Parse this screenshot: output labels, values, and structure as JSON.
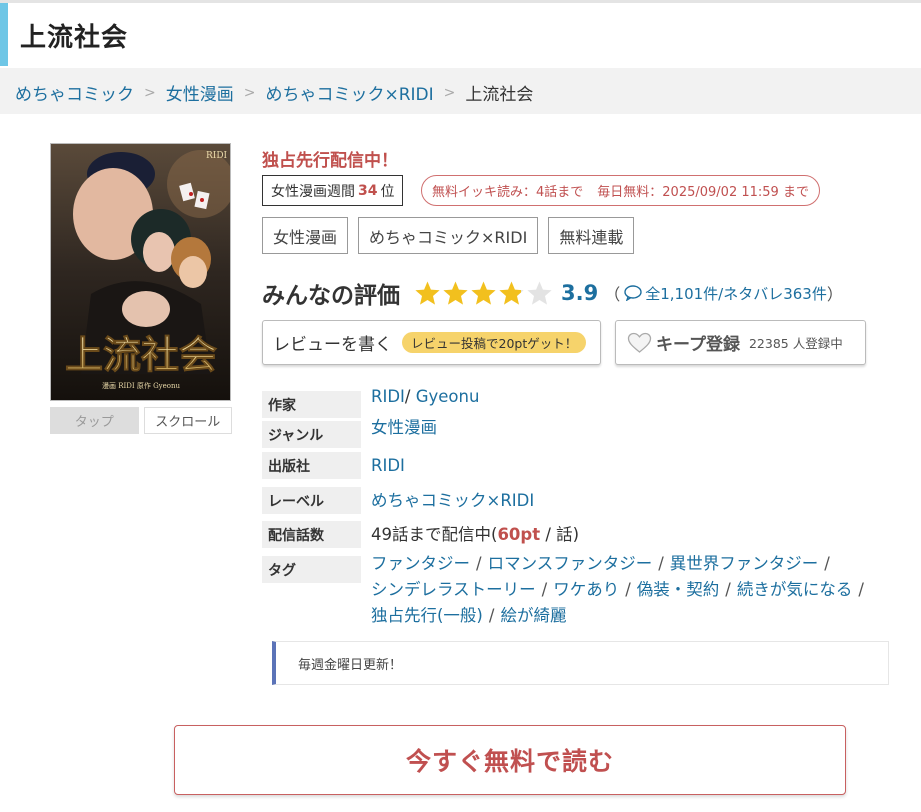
{
  "page": {
    "title": "上流社会"
  },
  "breadcrumb": [
    "めちゃコミック",
    "女性漫画",
    "めちゃコミック×RIDI",
    "上流社会"
  ],
  "cover": {
    "badge": "RIDI",
    "title_art": "上流社会",
    "credit": "漫画 RIDI  原作 Gyeonu",
    "tabs": [
      "タップ",
      "スクロール"
    ]
  },
  "header_info": {
    "exclusive": "独占先行配信中！",
    "rank_prefix": "女性漫画週間",
    "rank_num": "34",
    "rank_suffix": "位",
    "free_binge": "無料イッキ読み：4話まで",
    "daily_free": "毎日無料：2025/09/02 11:59 まで"
  },
  "category_buttons": [
    "女性漫画",
    "めちゃコミック×RIDI",
    "無料連載"
  ],
  "rating": {
    "label": "みんなの評価",
    "score": "3.9",
    "stars_value": 3.9,
    "paren_open": "（",
    "count_text": "全1,101件/ネタバレ363件",
    "paren_close": "）"
  },
  "review": {
    "label": "レビューを書く",
    "badge": "レビュー投稿で20ptゲット！"
  },
  "keep": {
    "label": "キープ登録",
    "count": "22385 人登録中"
  },
  "info": {
    "author_key": "作家",
    "author_1": "RIDI",
    "author_sep": "/",
    "author_2": "Gyeonu",
    "genre_key": "ジャンル",
    "genre": "女性漫画",
    "publisher_key": "出版社",
    "publisher": "RIDI",
    "label_key": "レーベル",
    "label": "めちゃコミック×RIDI",
    "episodes_key": "配信話数",
    "episodes_pre": "49話まで配信中(",
    "episodes_pt": "60pt",
    "episodes_post": " / 話)",
    "tags_key": "タグ",
    "tags": [
      "ファンタジー",
      "ロマンスファンタジー",
      "異世界ファンタジー",
      "シンデレラストーリー",
      "ワケあり",
      "偽装・契約",
      "続きが気になる",
      "独占先行(一般)",
      "絵が綺麗"
    ],
    "slash": "/"
  },
  "notice": "毎週金曜日更新！",
  "read_button": "今すぐ無料で読む",
  "colors": {
    "accent": "#6ec6e6",
    "link": "#1d6f9f",
    "red": "#c0504d",
    "star": "#f2c01e",
    "notice_bar": "#5b73b8"
  }
}
